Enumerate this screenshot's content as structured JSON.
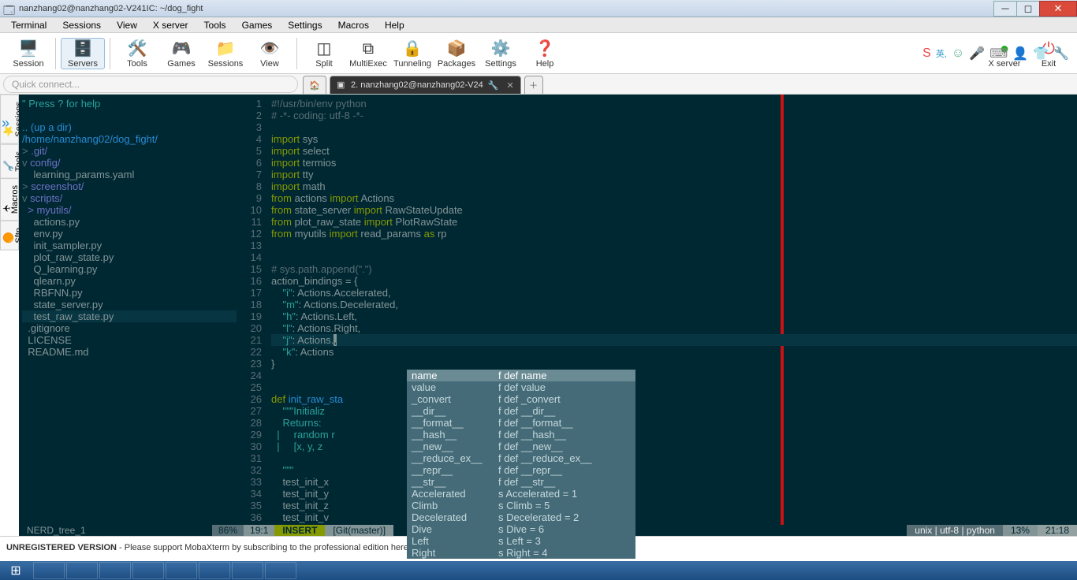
{
  "window": {
    "title": "nanzhang02@nanzhang02-V241IC: ~/dog_fight"
  },
  "menu": [
    "Terminal",
    "Sessions",
    "View",
    "X server",
    "Tools",
    "Games",
    "Settings",
    "Macros",
    "Help"
  ],
  "toolbar": [
    {
      "label": "Session",
      "icon": "🖥️"
    },
    {
      "label": "Servers",
      "icon": "🗄️"
    },
    {
      "label": "Tools",
      "icon": "🛠️"
    },
    {
      "label": "Games",
      "icon": "🎮"
    },
    {
      "label": "Sessions",
      "icon": "📁"
    },
    {
      "label": "View",
      "icon": "👁️"
    },
    {
      "label": "Split",
      "icon": "◫"
    },
    {
      "label": "MultiExec",
      "icon": "⧉"
    },
    {
      "label": "Tunneling",
      "icon": "🔒"
    },
    {
      "label": "Packages",
      "icon": "📦"
    },
    {
      "label": "Settings",
      "icon": "⚙️"
    },
    {
      "label": "Help",
      "icon": "❓"
    }
  ],
  "rightToolbar": {
    "xserver": "X server",
    "exit": "Exit"
  },
  "quickconnect": "Quick connect...",
  "tabs": {
    "active": "2. nanzhang02@nanzhang02-V24"
  },
  "sidetabs": [
    "Sessions",
    "Tools",
    "Macros",
    "Sftp"
  ],
  "nerdtree": {
    "header": "\" Press ? for help",
    "updir": ".. (up a dir)",
    "path": "/home/nanzhang02/dog_fight/",
    "entries": [
      {
        "t": ">",
        "name": ".git/",
        "cls": "c-dir"
      },
      {
        "t": "v",
        "name": "config/",
        "cls": "c-dir"
      },
      {
        "t": " ",
        "name": "  learning_params.yaml",
        "cls": ""
      },
      {
        "t": ">",
        "name": "screenshot/",
        "cls": "c-dir"
      },
      {
        "t": "v",
        "name": "scripts/",
        "cls": "c-dir"
      },
      {
        "t": " ",
        "name": "> myutils/",
        "cls": "c-dir"
      },
      {
        "t": " ",
        "name": "  actions.py",
        "cls": ""
      },
      {
        "t": " ",
        "name": "  env.py",
        "cls": ""
      },
      {
        "t": " ",
        "name": "  init_sampler.py",
        "cls": ""
      },
      {
        "t": " ",
        "name": "  plot_raw_state.py",
        "cls": ""
      },
      {
        "t": " ",
        "name": "  Q_learning.py",
        "cls": ""
      },
      {
        "t": " ",
        "name": "  qlearn.py",
        "cls": ""
      },
      {
        "t": " ",
        "name": "  RBFNN.py",
        "cls": ""
      },
      {
        "t": " ",
        "name": "  state_server.py",
        "cls": ""
      },
      {
        "t": " ",
        "name": "  test_raw_state.py",
        "cls": "",
        "hi": true
      },
      {
        "t": " ",
        "name": ".gitignore",
        "cls": ""
      },
      {
        "t": " ",
        "name": "LICENSE",
        "cls": ""
      },
      {
        "t": " ",
        "name": "README.md",
        "cls": ""
      }
    ]
  },
  "code": {
    "lines": [
      {
        "n": 1,
        "html": "<span class='c-comment'>#!/usr/bin/env python</span>"
      },
      {
        "n": 2,
        "html": "<span class='c-comment'># -*- coding: utf-8 -*-</span>"
      },
      {
        "n": 3,
        "html": ""
      },
      {
        "n": 4,
        "html": "<span class='c-kw'>import</span> sys"
      },
      {
        "n": 5,
        "html": "<span class='c-kw'>import</span> select"
      },
      {
        "n": 6,
        "html": "<span class='c-kw'>import</span> termios"
      },
      {
        "n": 7,
        "html": "<span class='c-kw'>import</span> tty"
      },
      {
        "n": 8,
        "html": "<span class='c-kw'>import</span> math"
      },
      {
        "n": 9,
        "html": "<span class='c-kw'>from</span> actions <span class='c-kw'>import</span> Actions"
      },
      {
        "n": 10,
        "html": "<span class='c-kw'>from</span> state_server <span class='c-kw'>import</span> RawStateUpdate"
      },
      {
        "n": 11,
        "html": "<span class='c-kw'>from</span> plot_raw_state <span class='c-kw'>import</span> PlotRawState"
      },
      {
        "n": 12,
        "html": "<span class='c-kw'>from</span> myutils <span class='c-kw'>import</span> read_params <span class='c-kw'>as</span> rp"
      },
      {
        "n": 13,
        "html": ""
      },
      {
        "n": 14,
        "html": ""
      },
      {
        "n": 15,
        "html": "<span class='c-comment'># sys.path.append(\".\")</span>"
      },
      {
        "n": 16,
        "html": "action_bindings = {"
      },
      {
        "n": 17,
        "html": "    <span class='c-str'>\"i\"</span>: Actions.Accelerated,"
      },
      {
        "n": 18,
        "html": "    <span class='c-str'>\"m\"</span>: Actions.Decelerated,"
      },
      {
        "n": 19,
        "html": "    <span class='c-str'>\"h\"</span>: Actions.Left,"
      },
      {
        "n": 20,
        "html": "    <span class='c-str'>\"l\"</span>: Actions.Right,"
      },
      {
        "n": 21,
        "html": "    <span class='c-str'>\"j\"</span>: Actions.<span class='c-cursor'>,</span>",
        "hi": true
      },
      {
        "n": 22,
        "html": "    <span class='c-str'>\"k\"</span>: Actions"
      },
      {
        "n": 23,
        "html": "}"
      },
      {
        "n": 24,
        "html": ""
      },
      {
        "n": 25,
        "html": ""
      },
      {
        "n": 26,
        "html": "<span class='c-kw'>def</span> <span class='c-fn'>init_raw_sta</span>"
      },
      {
        "n": 27,
        "html": "    <span class='c-str'>\"\"\"Initializ</span>"
      },
      {
        "n": 28,
        "html": "<span class='c-str'>    Returns:</span>"
      },
      {
        "n": 29,
        "html": "<span class='c-str'>  |     random r</span>"
      },
      {
        "n": 30,
        "html": "<span class='c-str'>  |     [x, y, z</span>"
      },
      {
        "n": 31,
        "html": ""
      },
      {
        "n": 32,
        "html": "    <span class='c-str'>\"\"\"</span>"
      },
      {
        "n": 33,
        "html": "    test_init_x"
      },
      {
        "n": 34,
        "html": "    test_init_y"
      },
      {
        "n": 35,
        "html": "    test_init_z"
      },
      {
        "n": 36,
        "html": "    test_init_v                                         <span class='c-fn'>w</span>(chi)"
      }
    ]
  },
  "autocomplete": [
    {
      "c1": "name",
      "c2": "f def name"
    },
    {
      "c1": "value",
      "c2": "f def value"
    },
    {
      "c1": "_convert",
      "c2": "f def _convert"
    },
    {
      "c1": "__dir__",
      "c2": "f def __dir__"
    },
    {
      "c1": "__format__",
      "c2": "f def __format__"
    },
    {
      "c1": "__hash__",
      "c2": "f def __hash__"
    },
    {
      "c1": "__new__",
      "c2": "f def __new__"
    },
    {
      "c1": "__reduce_ex__",
      "c2": "f def __reduce_ex__"
    },
    {
      "c1": "__repr__",
      "c2": "f def __repr__"
    },
    {
      "c1": "__str__",
      "c2": "f def __str__"
    },
    {
      "c1": "Accelerated",
      "c2": "s Accelerated = 1"
    },
    {
      "c1": "Climb",
      "c2": "s Climb = 5"
    },
    {
      "c1": "Decelerated",
      "c2": "s Decelerated = 2"
    },
    {
      "c1": "Dive",
      "c2": "s Dive = 6"
    },
    {
      "c1": "Left",
      "c2": "s Left = 3"
    },
    {
      "c1": "Right",
      "c2": "s Right = 4"
    }
  ],
  "status": {
    "nerdname": "NERD_tree_1",
    "nerdpct": "86%",
    "nerdpos": "19:1",
    "mode": "INSERT",
    "git": "[Git(master)]",
    "ff": "unix",
    "enc": "utf-8",
    "ft": "python",
    "pct": "13%",
    "pos": "21:18"
  },
  "bottom": {
    "text1": "UNREGISTERED VERSION",
    "text2": " - Please support MobaXterm by subscribing to the professional edition here: ",
    "link": "https://mobaxterm.mobatek.net"
  }
}
